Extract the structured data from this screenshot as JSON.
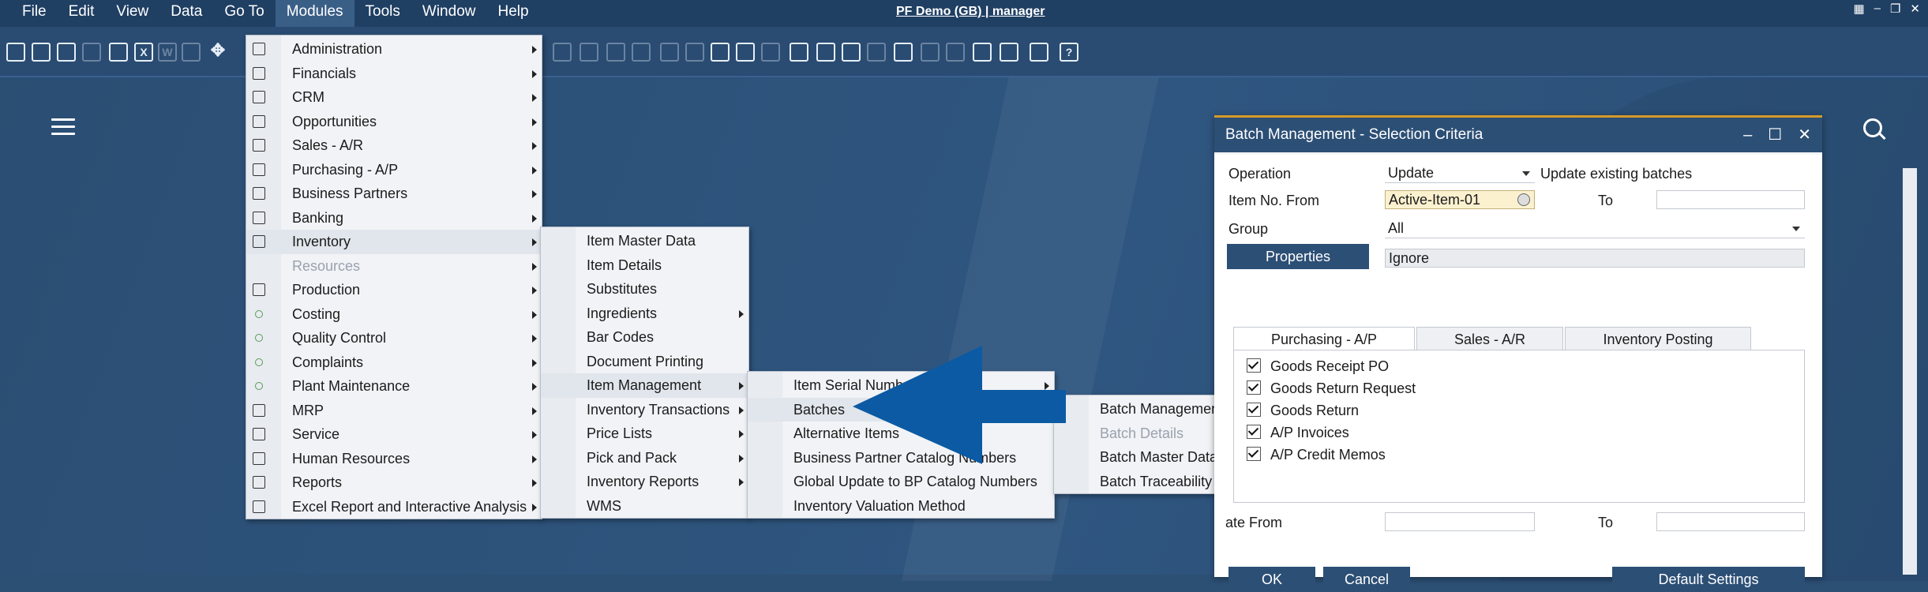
{
  "menubar": {
    "items": [
      "File",
      "Edit",
      "View",
      "Data",
      "Go To",
      "Modules",
      "Tools",
      "Window",
      "Help"
    ],
    "title": "PF Demo (GB) | manager"
  },
  "modules_menu": [
    {
      "label": "Administration",
      "icon": "settings-gear-icon",
      "submenu": true,
      "disabled": false
    },
    {
      "label": "Financials",
      "icon": "calculator-icon",
      "submenu": true,
      "disabled": false
    },
    {
      "label": "CRM",
      "icon": "people-icon",
      "submenu": true,
      "disabled": false
    },
    {
      "label": "Opportunities",
      "icon": "chart-star-icon",
      "submenu": true,
      "disabled": false
    },
    {
      "label": "Sales - A/R",
      "icon": "dollar-document-icon",
      "submenu": true,
      "disabled": false
    },
    {
      "label": "Purchasing - A/P",
      "icon": "shopping-cart-icon",
      "submenu": true,
      "disabled": false
    },
    {
      "label": "Business Partners",
      "icon": "contact-card-icon",
      "submenu": true,
      "disabled": false
    },
    {
      "label": "Banking",
      "icon": "money-bag-icon",
      "submenu": true,
      "disabled": false
    },
    {
      "label": "Inventory",
      "icon": "inventory-truck-icon",
      "submenu": true,
      "disabled": false
    },
    {
      "label": "Resources",
      "icon": "",
      "submenu": true,
      "disabled": true
    },
    {
      "label": "Production",
      "icon": "production-icon",
      "submenu": true,
      "disabled": false
    },
    {
      "label": "Costing",
      "icon": "costing-icon",
      "submenu": true,
      "disabled": false
    },
    {
      "label": "Quality Control",
      "icon": "quality-icon",
      "submenu": true,
      "disabled": false
    },
    {
      "label": "Complaints",
      "icon": "complaints-icon",
      "submenu": true,
      "disabled": false
    },
    {
      "label": "Plant Maintenance",
      "icon": "wrench-icon",
      "submenu": true,
      "disabled": false
    },
    {
      "label": "MRP",
      "icon": "calendar-icon",
      "submenu": true,
      "disabled": false
    },
    {
      "label": "Service",
      "icon": "bank-icon",
      "submenu": true,
      "disabled": false
    },
    {
      "label": "Human Resources",
      "icon": "person-icon",
      "submenu": true,
      "disabled": false
    },
    {
      "label": "Reports",
      "icon": "report-icon",
      "submenu": true,
      "disabled": false
    },
    {
      "label": "Excel Report and Interactive Analysis",
      "icon": "excel-icon",
      "submenu": true,
      "disabled": false
    }
  ],
  "inventory_menu": [
    {
      "label": "Item Master Data",
      "submenu": false
    },
    {
      "label": "Item Details",
      "submenu": false
    },
    {
      "label": "Substitutes",
      "submenu": false
    },
    {
      "label": "Ingredients",
      "submenu": true
    },
    {
      "label": "Bar Codes",
      "submenu": false
    },
    {
      "label": "Document Printing",
      "submenu": false
    },
    {
      "label": "Item Management",
      "submenu": true
    },
    {
      "label": "Inventory Transactions",
      "submenu": true
    },
    {
      "label": "Price Lists",
      "submenu": true
    },
    {
      "label": "Pick and Pack",
      "submenu": true
    },
    {
      "label": "Inventory Reports",
      "submenu": true
    },
    {
      "label": "WMS",
      "submenu": false
    }
  ],
  "item_management_menu": [
    {
      "label": "Item Serial Numbers",
      "submenu": true
    },
    {
      "label": "Batches",
      "submenu": true
    },
    {
      "label": "Alternative Items",
      "submenu": false
    },
    {
      "label": "Business Partner Catalog Numbers",
      "submenu": false
    },
    {
      "label": "Global Update to BP Catalog Numbers",
      "submenu": false
    },
    {
      "label": "Inventory Valuation Method",
      "submenu": false
    }
  ],
  "batches_menu": [
    {
      "label": "Batch Management",
      "disabled": false
    },
    {
      "label": "Batch Details",
      "disabled": true
    },
    {
      "label": "Batch Master Data",
      "disabled": false
    },
    {
      "label": "Batch Traceability",
      "disabled": false
    }
  ],
  "dialog": {
    "title": "Batch Management - Selection Criteria",
    "operation_label": "Operation",
    "operation_value": "Update",
    "operation_desc": "Update existing batches",
    "item_from_label": "Item No. From",
    "item_from_value": "Active-Item-01",
    "to_label": "To",
    "group_label": "Group",
    "group_value": "All",
    "properties_button": "Properties",
    "properties_value": "Ignore",
    "tabs": [
      "Purchasing - A/P",
      "Sales - A/R",
      "Inventory Posting"
    ],
    "checkboxes": [
      "Goods Receipt PO",
      "Goods Return Request",
      "Goods Return",
      "A/P Invoices",
      "A/P Credit Memos"
    ],
    "date_from_label": "ate From",
    "date_to_label": "To",
    "ok_button": "OK",
    "cancel_button": "Cancel",
    "default_settings_button": "Default Settings"
  },
  "colors": {
    "menubar": "#1f3f63",
    "desktop": "#2c4f74",
    "dialog_title": "#2c4f75",
    "arrow": "#0b5aa3",
    "highlight_field": "#fbf1cf"
  }
}
